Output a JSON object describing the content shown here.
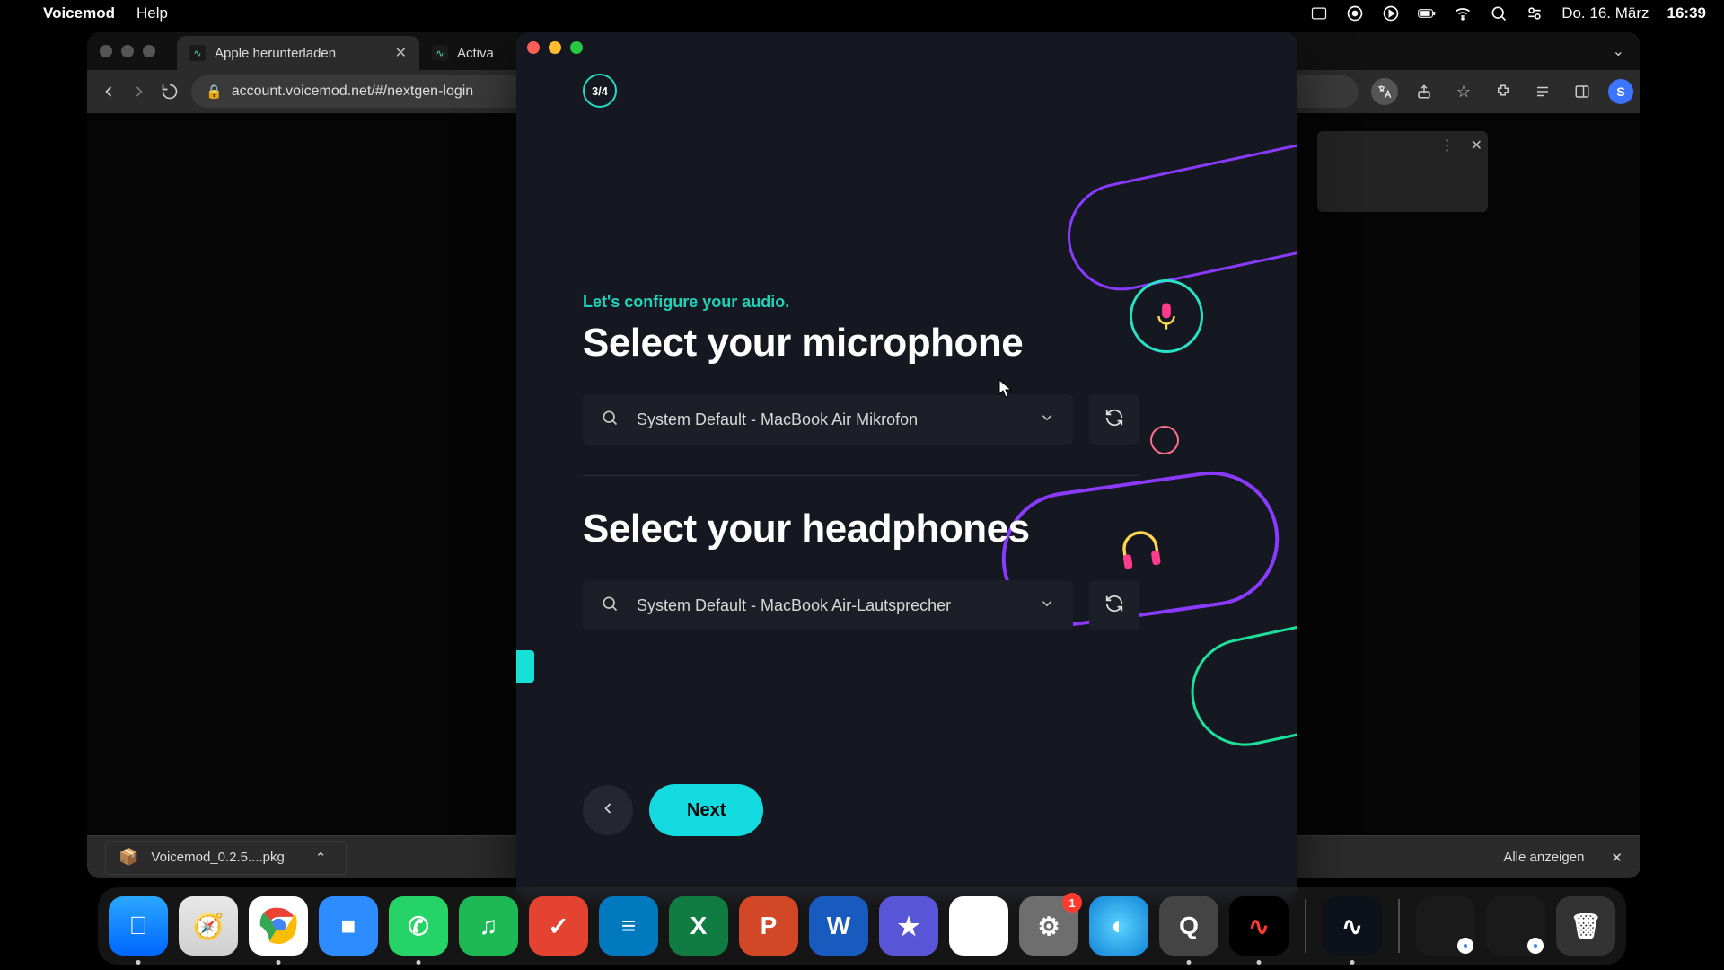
{
  "menubar": {
    "app_name": "Voicemod",
    "menu_help": "Help",
    "date": "Do. 16. März",
    "time": "16:39"
  },
  "chrome": {
    "tab1_title": "Apple herunterladen",
    "tab2_title": "Activa",
    "url": "account.voicemod.net/#/nextgen-login",
    "profile_initial": "S",
    "download_item": "Voicemod_0.2.5....pkg",
    "show_all": "Alle anzeigen"
  },
  "vm": {
    "step": "3/4",
    "subtitle": "Let's configure your audio.",
    "mic_title": "Select your microphone",
    "mic_value": "System Default - MacBook Air Mikrofon",
    "hp_title": "Select your headphones",
    "hp_value": "System Default - MacBook Air-Lautsprecher",
    "next": "Next"
  },
  "dock": {
    "settings_badge": "1"
  }
}
